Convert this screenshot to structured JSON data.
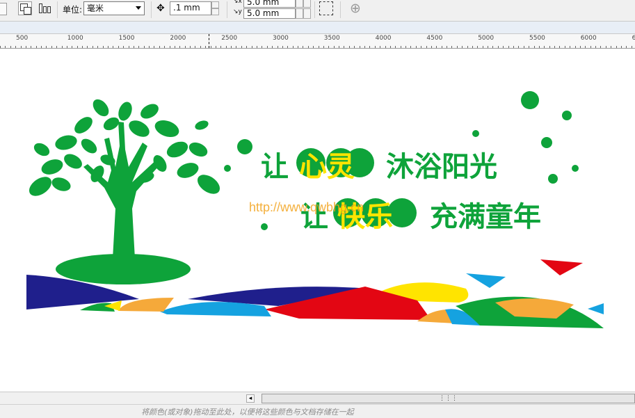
{
  "toolbar": {
    "unit_label": "单位:",
    "unit_value": "毫米",
    "nudge_value": ".1 mm",
    "dup_x": "5.0 mm",
    "dup_y": "5.0 mm"
  },
  "ruler": {
    "labels": [
      "500",
      "1000",
      "1500",
      "2000",
      "2500",
      "3000",
      "3500",
      "4000",
      "4500",
      "5000",
      "5500",
      "6000",
      "6"
    ]
  },
  "artwork": {
    "line1": {
      "pre": "让",
      "highlight": "心灵",
      "post": "沐浴阳光"
    },
    "line2": {
      "pre": "让",
      "highlight": "快乐",
      "post": "充满童年"
    },
    "watermark": "http://www.qwbhg.cn",
    "colors": {
      "green": "#0ea33a",
      "yellow": "#ffe400",
      "navy": "#1f1f8c",
      "red": "#e30613",
      "orange": "#f5a93a",
      "sky": "#15a2e0"
    }
  },
  "status": {
    "hint": "将颜色(或对象)拖动至此处，以便将这些颜色与文档存储在一起"
  }
}
